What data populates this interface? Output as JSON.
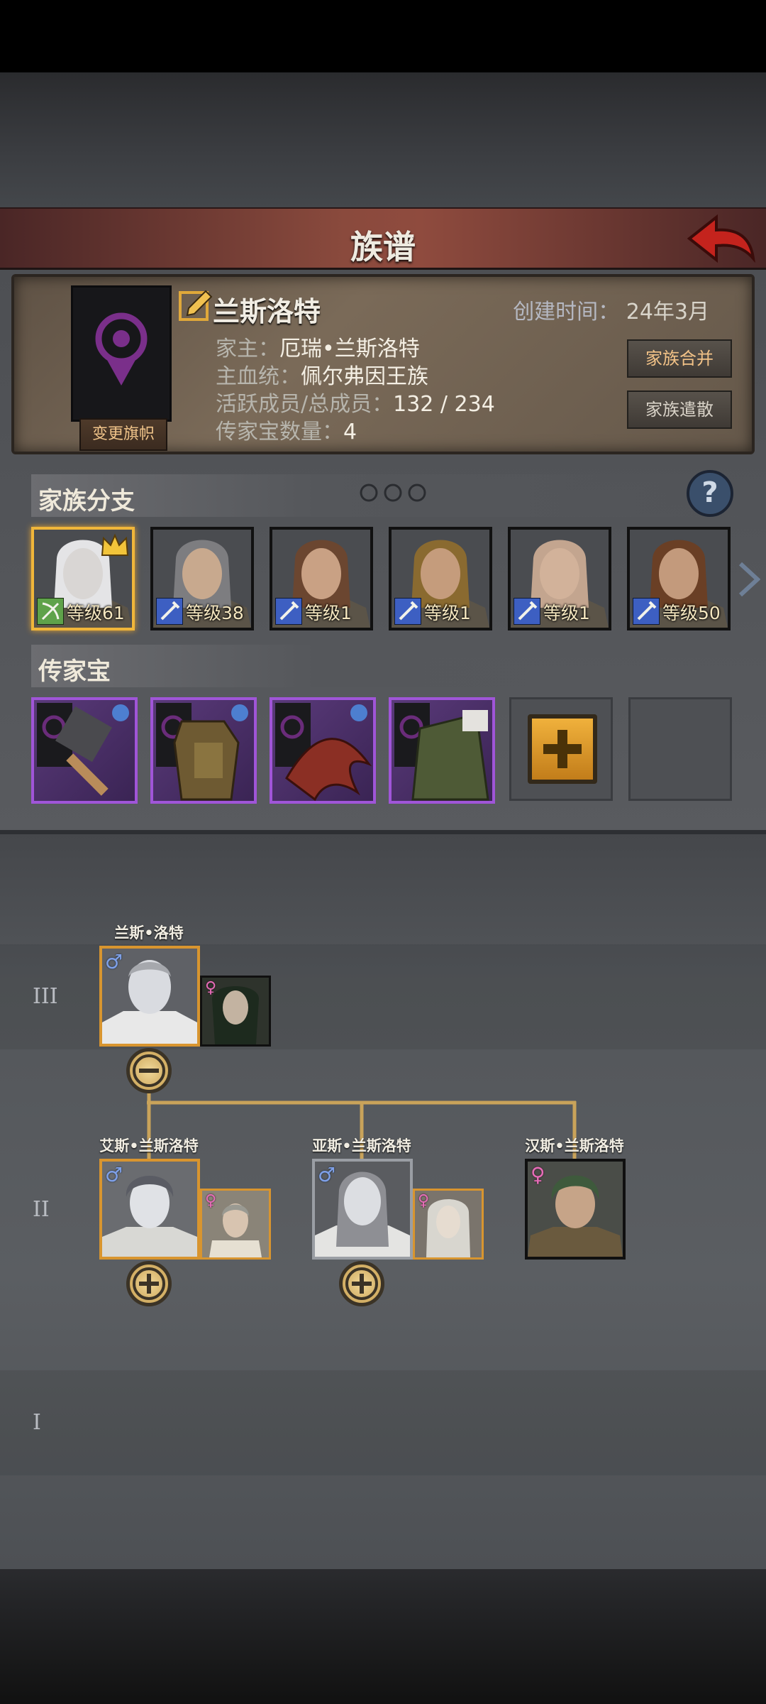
{
  "title": "族谱",
  "family": {
    "name": "兰斯洛特",
    "created_label": "创建时间：",
    "created_value": "24年3月",
    "head_label": "家主：",
    "head_value": "厄瑞•兰斯洛特",
    "bloodline_label": "主血统：",
    "bloodline_value": "佩尔弗因王族",
    "members_label": "活跃成员/总成员：",
    "members_value": "132 / 234",
    "heirloom_label": "传家宝数量：",
    "heirloom_value": "4",
    "change_banner": "变更旗帜",
    "merge": "家族合并",
    "disband": "家族遣散"
  },
  "branches": {
    "title": "家族分支",
    "members": [
      {
        "level": "等级61",
        "class": "bow",
        "crown": true,
        "selected": true,
        "hair": "#e4e4e6",
        "skin": "#d9d6d4"
      },
      {
        "level": "等级38",
        "class": "sword",
        "crown": false,
        "selected": false,
        "hair": "#7d7d80",
        "skin": "#c8a98e"
      },
      {
        "level": "等级1",
        "class": "sword",
        "crown": false,
        "selected": false,
        "hair": "#6b4630",
        "skin": "#c9a184"
      },
      {
        "level": "等级1",
        "class": "sword",
        "crown": false,
        "selected": false,
        "hair": "#8a6a30",
        "skin": "#c59c7c"
      },
      {
        "level": "等级1",
        "class": "sword",
        "crown": false,
        "selected": false,
        "hair": "#c3a58f",
        "skin": "#d2b29a"
      },
      {
        "level": "等级50",
        "class": "sword",
        "crown": false,
        "selected": false,
        "hair": "#6a3f25",
        "skin": "#c39a7c"
      }
    ]
  },
  "heirlooms": {
    "title": "传家宝",
    "items": [
      {
        "name": "hammer"
      },
      {
        "name": "armor"
      },
      {
        "name": "claw"
      },
      {
        "name": "cloak"
      }
    ]
  },
  "tree": {
    "generations": [
      "III",
      "II",
      "I"
    ],
    "gen3": {
      "name": "兰斯•洛特"
    },
    "gen2": [
      {
        "name": "艾斯•兰斯洛特"
      },
      {
        "name": "亚斯•兰斯洛特"
      },
      {
        "name": "汉斯•兰斯洛特"
      }
    ]
  },
  "colors": {
    "accent_gold": "#d8952f",
    "rarity_purple": "#a055d8",
    "title_red": "#8f4b3e"
  }
}
